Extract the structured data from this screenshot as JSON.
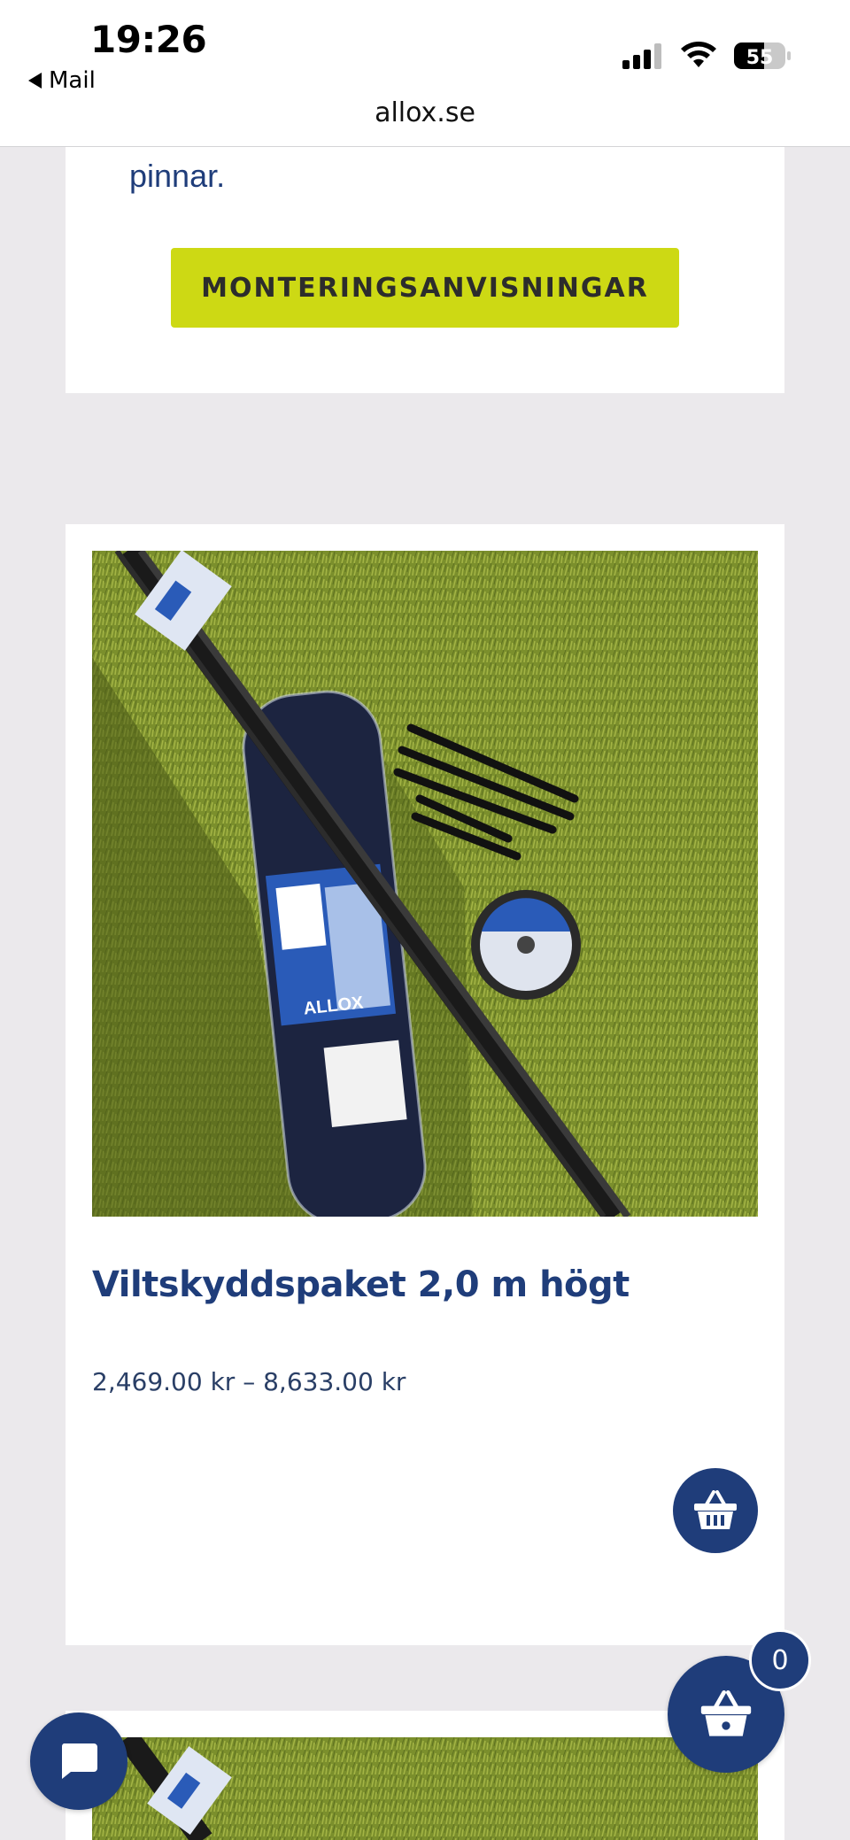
{
  "status_bar": {
    "time": "19:26",
    "back_label": "Mail",
    "battery_level": "55"
  },
  "browser": {
    "url": "allox.se"
  },
  "section_top": {
    "text_fragment": "pinnar.",
    "button_label": "MONTERINGSANVISNINGAR"
  },
  "product": {
    "title": "Viltskyddspaket 2,0 m högt",
    "price": "2,469.00 kr – 8,633.00 kr",
    "image_brand_text": "ALLOX"
  },
  "cart": {
    "count": "0"
  },
  "colors": {
    "brand_blue": "#1f3d7a",
    "accent_lime": "#cdd914",
    "page_bg": "#ebe9ec"
  },
  "icons": {
    "back": "back-triangle-icon",
    "signal": "cellular-signal-icon",
    "wifi": "wifi-icon",
    "battery": "battery-icon",
    "add_to_cart": "basket-icon",
    "cart": "basket-icon",
    "chat": "chat-bubble-icon"
  }
}
